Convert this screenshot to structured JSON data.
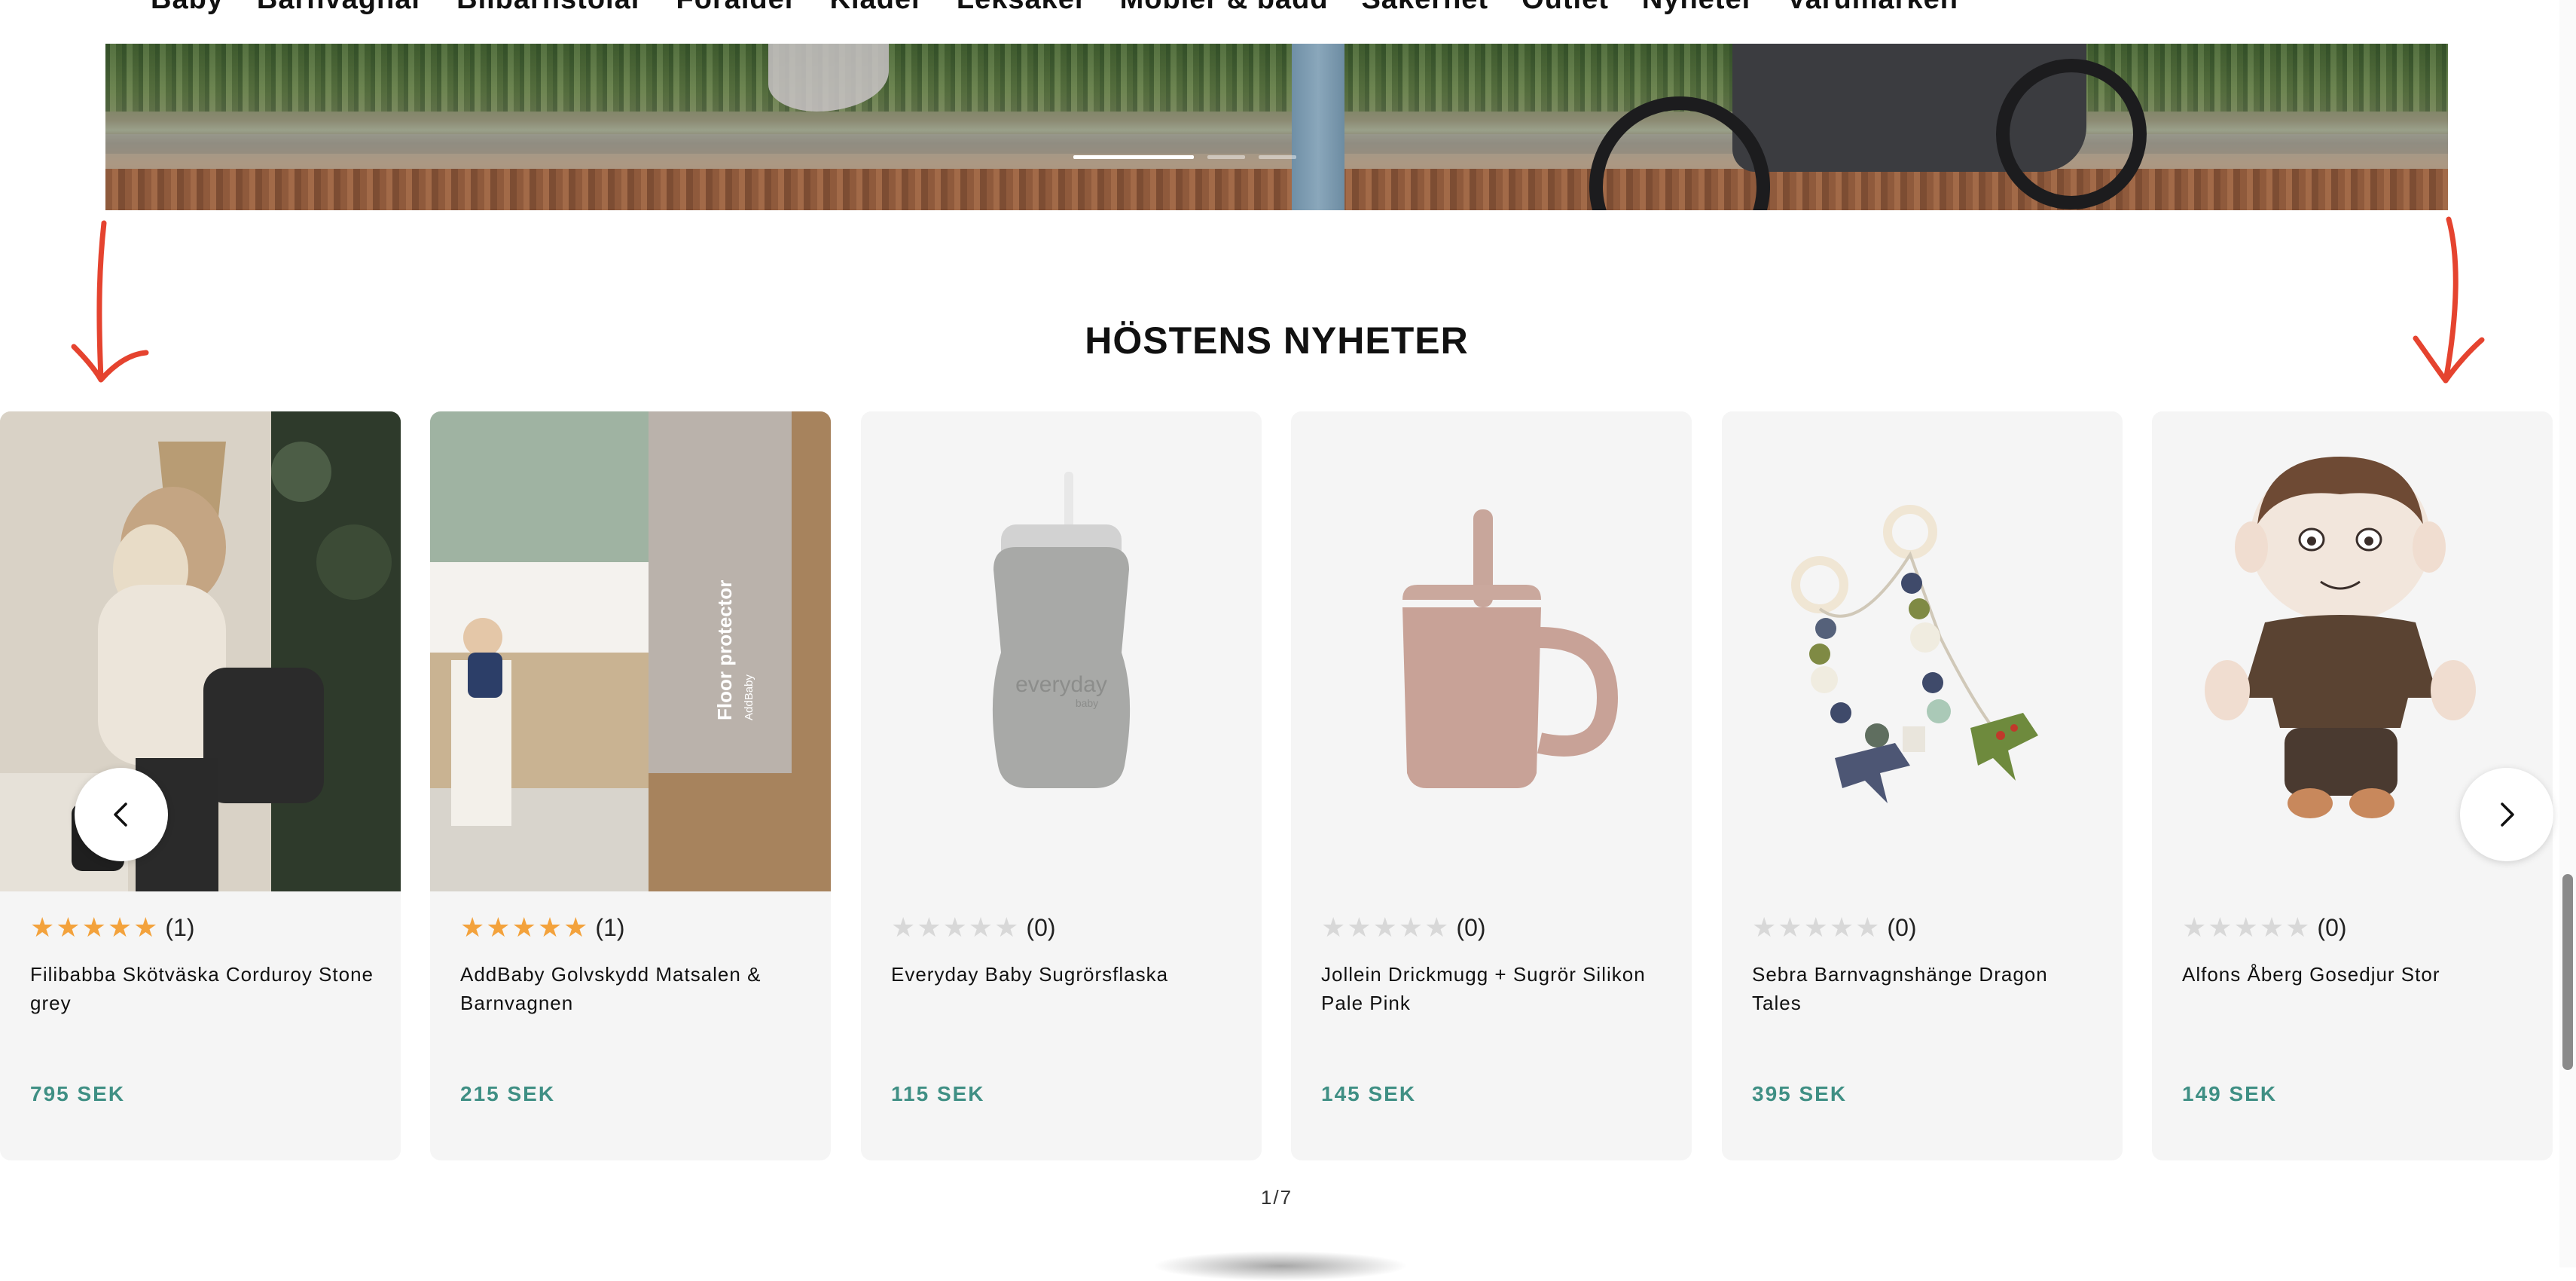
{
  "nav": {
    "items": [
      "Baby",
      "Barnvagnar",
      "Bilbarnstolar",
      "Förälder",
      "Kläder",
      "Leksaker",
      "Möbler & bädd",
      "Säkerhet",
      "Outlet",
      "Nyheter",
      "Varumärken"
    ]
  },
  "hero": {
    "slides_total": 3,
    "active_slide": 1
  },
  "section": {
    "title": "HÖSTENS NYHETER"
  },
  "products": [
    {
      "name": "Filibabba Skötväska Corduroy Stone grey",
      "rating": 5,
      "rating_count": "(1)",
      "price": "795 SEK"
    },
    {
      "name": "AddBaby Golvskydd Matsalen & Barnvagnen",
      "rating": 5,
      "rating_count": "(1)",
      "price": "215 SEK",
      "image_text": [
        "Floor protector",
        "AddBaby"
      ]
    },
    {
      "name": "Everyday Baby Sugrörsflaska",
      "rating": 0,
      "rating_count": "(0)",
      "price": "115 SEK",
      "image_text": [
        "everyday",
        "baby"
      ]
    },
    {
      "name": "Jollein Drickmugg + Sugrör Silikon Pale Pink",
      "rating": 0,
      "rating_count": "(0)",
      "price": "145 SEK"
    },
    {
      "name": "Sebra Barnvagnshänge Dragon Tales",
      "rating": 0,
      "rating_count": "(0)",
      "price": "395 SEK"
    },
    {
      "name": "Alfons Åberg Gosedjur Stor",
      "rating": 0,
      "rating_count": "(0)",
      "price": "149 SEK"
    }
  ],
  "carousel": {
    "pager": "1/7"
  },
  "icons": {
    "prev": "chevron-left-icon",
    "next": "chevron-right-icon",
    "star": "star-icon"
  },
  "colors": {
    "price": "#3f8f84",
    "star_on": "#f3a23c",
    "star_off": "#d8d8d8",
    "annotation_arrow": "#e5432f"
  }
}
